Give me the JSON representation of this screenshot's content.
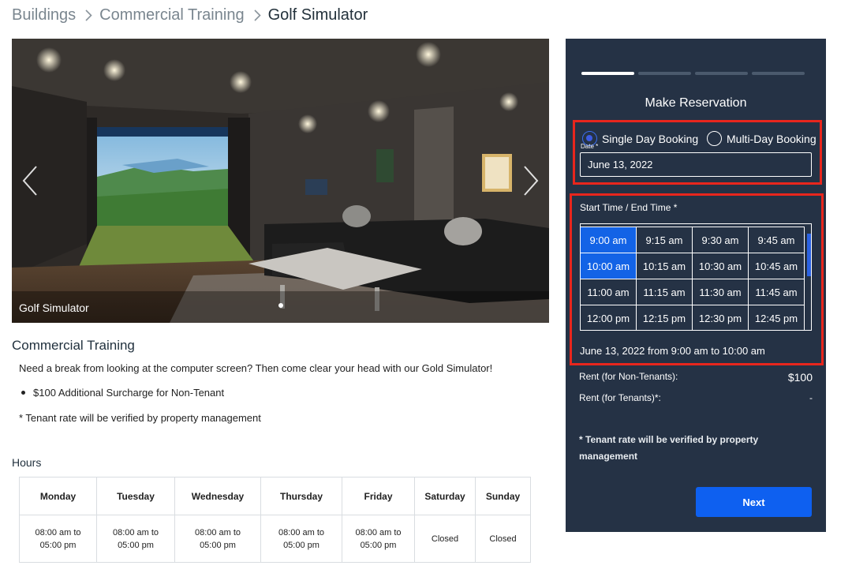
{
  "breadcrumb": {
    "items": [
      "Buildings",
      "Commercial Training"
    ],
    "current": "Golf Simulator"
  },
  "hero": {
    "caption": "Golf Simulator",
    "slide_count": 1,
    "active_slide": 1
  },
  "content": {
    "section_title": "Commercial Training",
    "description": "Need a break from looking at the computer screen? Then come clear your head with our Gold Simulator!",
    "bullets": [
      "$100 Additional Surcharge for Non-Tenant"
    ],
    "note": "* Tenant rate will be verified by property management"
  },
  "hours": {
    "title": "Hours",
    "days": [
      "Monday",
      "Tuesday",
      "Wednesday",
      "Thursday",
      "Friday",
      "Saturday",
      "Sunday"
    ],
    "values": [
      [
        "08:00 am to",
        "05:00 pm"
      ],
      [
        "08:00 am to",
        "05:00 pm"
      ],
      [
        "08:00 am to",
        "05:00 pm"
      ],
      [
        "08:00 am to",
        "05:00 pm"
      ],
      [
        "08:00 am to",
        "05:00 pm"
      ],
      [
        "Closed",
        ""
      ],
      [
        "Closed",
        ""
      ]
    ]
  },
  "reservation": {
    "title": "Make Reservation",
    "steps_total": 4,
    "current_step": 1,
    "booking_options": [
      {
        "label": "Single Day Booking",
        "checked": true
      },
      {
        "label": "Multi-Day Booking",
        "checked": false
      }
    ],
    "date_label": "Date *",
    "date_value": "June 13, 2022",
    "time_label": "Start Time / End Time *",
    "time_slots": [
      [
        "9:00 am",
        "9:15 am",
        "9:30 am",
        "9:45 am"
      ],
      [
        "10:00 am",
        "10:15 am",
        "10:30 am",
        "10:45 am"
      ],
      [
        "11:00 am",
        "11:15 am",
        "11:30 am",
        "11:45 am"
      ],
      [
        "12:00 pm",
        "12:15 pm",
        "12:30 pm",
        "12:45 pm"
      ]
    ],
    "selected_slots": [
      "9:00 am",
      "10:00 am"
    ],
    "summary": "June 13, 2022 from 9:00 am to 10:00 am",
    "rent_non_tenants_label": "Rent (for Non-Tenants):",
    "rent_non_tenants_value": "$100",
    "rent_tenants_label": "Rent (for Tenants)*:",
    "rent_tenants_value": "-",
    "note": "* Tenant rate will be verified by property management",
    "next_label": "Next",
    "colors": {
      "panel_bg": "#253245",
      "accent": "#1363e6",
      "highlight_border": "#e8261d"
    }
  }
}
